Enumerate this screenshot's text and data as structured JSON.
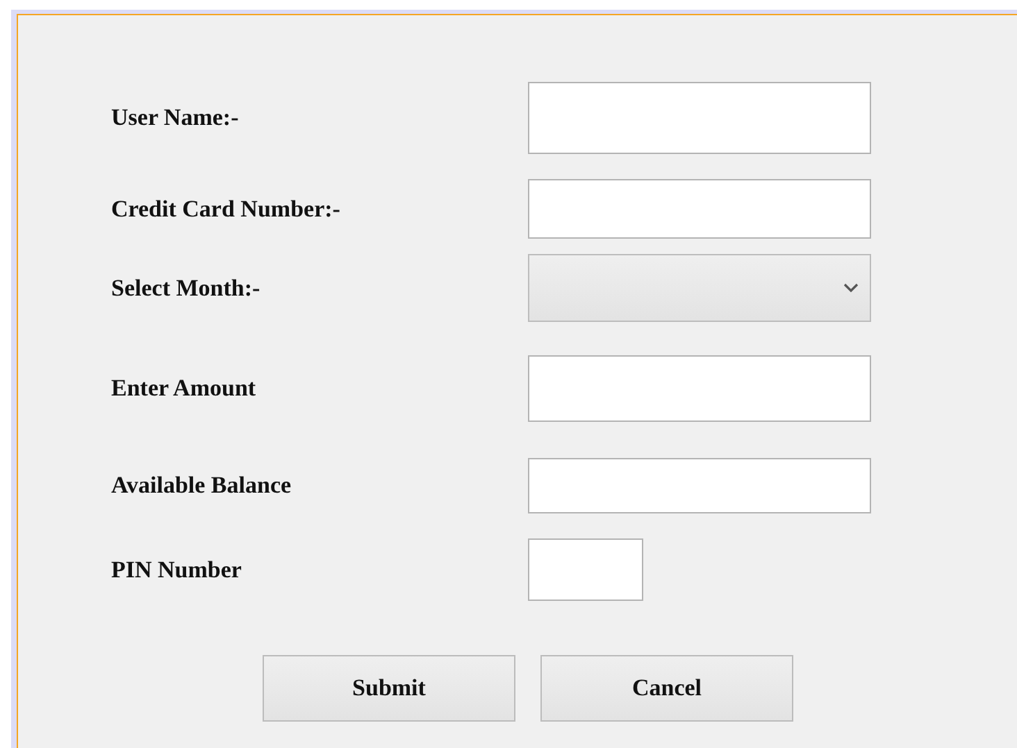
{
  "form": {
    "fields": [
      {
        "label": "User Name:-",
        "kind": "text"
      },
      {
        "label": "Credit Card Number:-",
        "kind": "text"
      },
      {
        "label": "Select Month:-",
        "kind": "select"
      },
      {
        "label": "Enter Amount",
        "kind": "text"
      },
      {
        "label": "Available Balance",
        "kind": "text"
      },
      {
        "label": "PIN Number",
        "kind": "short-text"
      }
    ],
    "buttons": [
      "Submit",
      "Cancel"
    ]
  }
}
